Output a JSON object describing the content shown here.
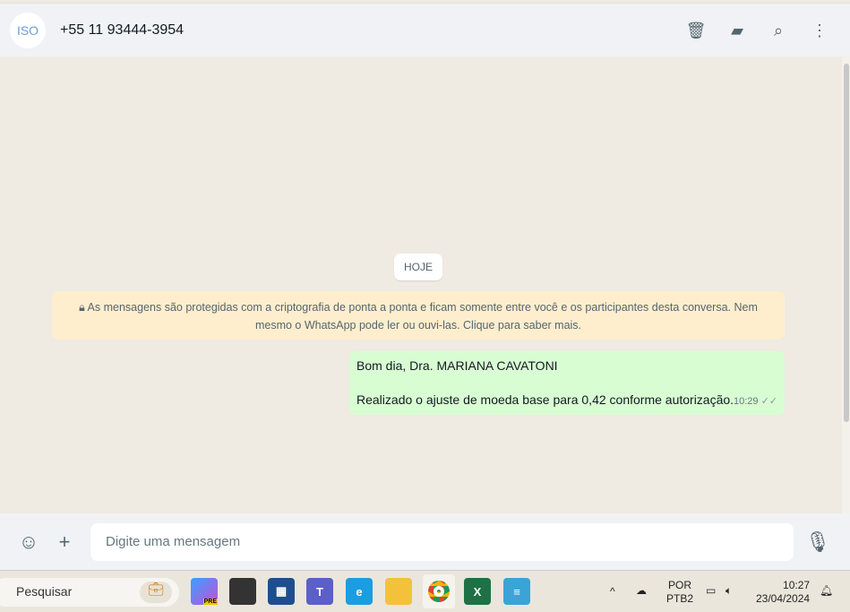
{
  "header": {
    "avatar_text": "ISO",
    "contact": "+55 11 93444-3954"
  },
  "chat": {
    "date_chip": "HOJE",
    "encryption_notice": "As mensagens são protegidas com a criptografia de ponta a ponta e ficam somente entre você e os participantes desta conversa. Nem mesmo o WhatsApp pode ler ou ouvi-las. Clique para saber mais.",
    "messages": [
      {
        "line1": "Bom dia, Dra. MARIANA CAVATONI",
        "line2": "Realizado o ajuste de moeda base para 0,42 conforme autorização.",
        "time": "10:29",
        "status": "✓✓"
      }
    ]
  },
  "compose": {
    "placeholder": "Digite uma mensagem"
  },
  "taskbar": {
    "search": "Pesquisar",
    "lang1": "POR",
    "lang2": "PTB2",
    "time": "10:27",
    "date": "23/04/2024",
    "copilot_badge": "PRE"
  }
}
